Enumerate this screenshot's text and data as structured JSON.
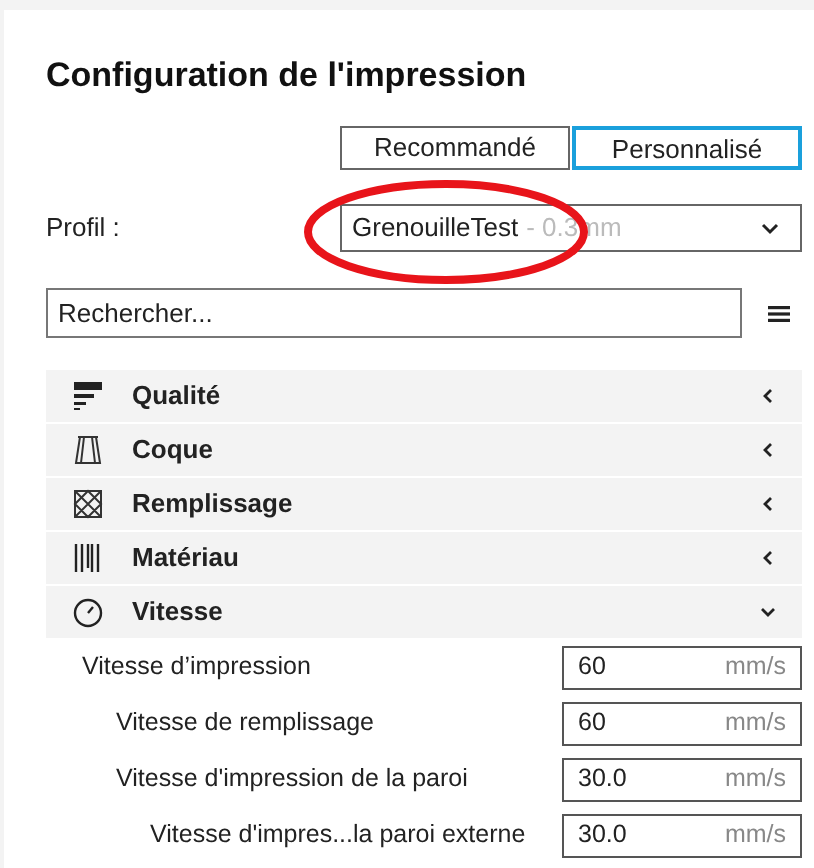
{
  "title": "Configuration de l'impression",
  "modes": [
    {
      "label": "Recommandé",
      "selected": false
    },
    {
      "label": "Personnalisé",
      "selected": true
    }
  ],
  "profile": {
    "label": "Profil :",
    "name": "GrenouilleTest",
    "suffix": "- 0.3mm"
  },
  "search": {
    "placeholder": "Rechercher..."
  },
  "categories": [
    {
      "kind": "quality",
      "label": "Qualité",
      "expanded": false
    },
    {
      "kind": "shell",
      "label": "Coque",
      "expanded": false
    },
    {
      "kind": "infill",
      "label": "Remplissage",
      "expanded": false
    },
    {
      "kind": "material",
      "label": "Matériau",
      "expanded": false
    },
    {
      "kind": "speed",
      "label": "Vitesse",
      "expanded": true,
      "settings": [
        {
          "label": "Vitesse d’impression",
          "value": "60",
          "unit": "mm/s",
          "children": [
            {
              "label": "Vitesse de remplissage",
              "value": "60",
              "unit": "mm/s"
            },
            {
              "label": "Vitesse d'impression de la paroi",
              "value": "30.0",
              "unit": "mm/s",
              "children": [
                {
                  "label": "Vitesse d'impres...la paroi externe",
                  "value": "30.0",
                  "unit": "mm/s"
                }
              ]
            }
          ]
        }
      ]
    }
  ]
}
